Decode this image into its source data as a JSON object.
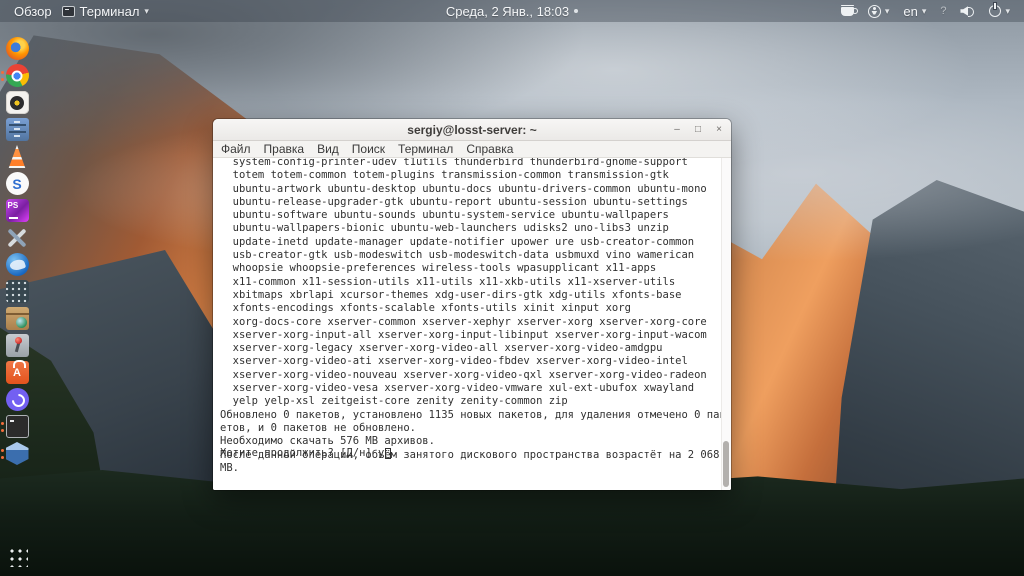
{
  "top_bar": {
    "overview_label": "Обзор",
    "app_menu_label": "Терминал",
    "caret": "▾",
    "clock": "Среда, 2 Янв., 18:03",
    "keyboard_layout": "en",
    "question_indicator": "?",
    "icons": [
      "terminal-mini-icon",
      "coffee-cup-icon",
      "accessibility-icon",
      "keyboard-layout-indicator",
      "question-indicator",
      "volume-icon",
      "power-icon"
    ]
  },
  "launcher": {
    "icons": [
      "firefox",
      "chrome",
      "camera-lens-app",
      "file-cabinet-app",
      "vlc",
      "s-logo-app",
      "phpstorm",
      "tools-app",
      "thunderbird",
      "calculator",
      "package-globe-app",
      "lever-switch-app",
      "ubuntu-software",
      "viber",
      "terminal",
      "virtualbox",
      "show-apps-grid"
    ],
    "phpstorm_label": "PS",
    "s_app_label": "S",
    "software_label": "A",
    "running_dot_color": "#f26d3c"
  },
  "terminal": {
    "title": "sergiy@losst-server: ~",
    "window_buttons": {
      "minimize": "–",
      "maximize": "□",
      "close": "×"
    },
    "menu": [
      "Файл",
      "Правка",
      "Вид",
      "Поиск",
      "Терминал",
      "Справка"
    ],
    "output_lines": [
      "  system-config-printer-udev t1utils thunderbird thunderbird-gnome-support",
      "  totem totem-common totem-plugins transmission-common transmission-gtk",
      "  ubuntu-artwork ubuntu-desktop ubuntu-docs ubuntu-drivers-common ubuntu-mono",
      "  ubuntu-release-upgrader-gtk ubuntu-report ubuntu-session ubuntu-settings",
      "  ubuntu-software ubuntu-sounds ubuntu-system-service ubuntu-wallpapers",
      "  ubuntu-wallpapers-bionic ubuntu-web-launchers udisks2 uno-libs3 unzip",
      "  update-inetd update-manager update-notifier upower ure usb-creator-common",
      "  usb-creator-gtk usb-modeswitch usb-modeswitch-data usbmuxd vino wamerican",
      "  whoopsie whoopsie-preferences wireless-tools wpasupplicant x11-apps",
      "  x11-common x11-session-utils x11-utils x11-xkb-utils x11-xserver-utils",
      "  xbitmaps xbrlapi xcursor-themes xdg-user-dirs-gtk xdg-utils xfonts-base",
      "  xfonts-encodings xfonts-scalable xfonts-utils xinit xinput xorg",
      "  xorg-docs-core xserver-common xserver-xephyr xserver-xorg xserver-xorg-core",
      "  xserver-xorg-input-all xserver-xorg-input-libinput xserver-xorg-input-wacom",
      "  xserver-xorg-legacy xserver-xorg-video-all xserver-xorg-video-amdgpu",
      "  xserver-xorg-video-ati xserver-xorg-video-fbdev xserver-xorg-video-intel",
      "  xserver-xorg-video-nouveau xserver-xorg-video-qxl xserver-xorg-video-radeon",
      "  xserver-xorg-video-vesa xserver-xorg-video-vmware xul-ext-ubufox xwayland",
      "  yelp yelp-xsl zeitgeist-core zenity zenity-common zip",
      "Обновлено 0 пакетов, установлено 1135 новых пакетов, для удаления отмечено 0 пак",
      "етов, и 0 пакетов не обновлено.",
      "Необходимо скачать 576 MB архивов.",
      "После данной операции, объём занятого дискового пространства возрастёт на 2 068",
      "MB."
    ],
    "prompt_line": "Хотите продолжить? [Д/н] y"
  },
  "colors": {
    "panel_bg": "rgba(56,64,74,0.38)",
    "terminal_bg": "#ffffff",
    "terminal_fg": "#303030",
    "titlebar_bg": "#f1efed",
    "accent_orange": "#e95420"
  }
}
